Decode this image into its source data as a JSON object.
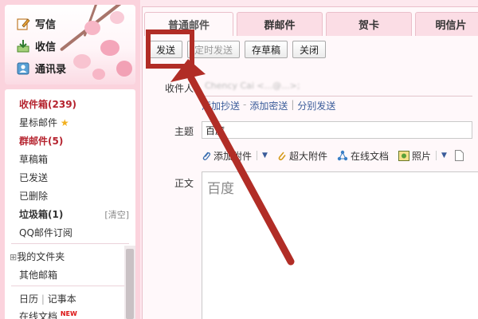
{
  "sidebar": {
    "top_items": [
      {
        "label": "写信",
        "icon": "pencil-icon"
      },
      {
        "label": "收信",
        "icon": "inbox-download-icon"
      },
      {
        "label": "通讯录",
        "icon": "contacts-icon"
      }
    ],
    "folders": [
      {
        "label": "收件箱",
        "count": "(239)"
      },
      {
        "label": "星标邮件",
        "icon": "star-icon"
      },
      {
        "label": "群邮件",
        "count": "(5)"
      },
      {
        "label": "草稿箱"
      },
      {
        "label": "已发送"
      },
      {
        "label": "已删除"
      },
      {
        "label": "垃圾箱",
        "count": "(1)",
        "action": "[清空]"
      },
      {
        "label": "QQ邮件订阅"
      }
    ],
    "lower_items": [
      {
        "label": "我的文件夹",
        "toggle": "⊞"
      },
      {
        "label": "其他邮箱"
      },
      {
        "label": "日历",
        "extra": "记事本"
      },
      {
        "label": "在线文档",
        "badge": "NEW"
      }
    ],
    "colors": {
      "accent": "#b5232e",
      "panel": "#fbd3dd"
    }
  },
  "tabs": [
    "普通邮件",
    "群邮件",
    "贺卡",
    "明信片"
  ],
  "toolbar": {
    "send": "发送",
    "scheduled_send": "定时发送",
    "save_draft": "存草稿",
    "close": "关闭"
  },
  "compose": {
    "recipient_label": "收件人",
    "recipient_value": "Chency Cai <...@...>;",
    "cc_links": [
      "添加抄送",
      "添加密送",
      "分别发送"
    ],
    "subject_label": "主题",
    "subject_value": "百度",
    "attachments": [
      {
        "label": "添加附件",
        "icon": "paperclip-icon",
        "dropdown": true
      },
      {
        "label": "超大附件",
        "icon": "large-attachment-icon"
      },
      {
        "label": "在线文档",
        "icon": "share-doc-icon"
      },
      {
        "label": "照片",
        "icon": "photo-icon",
        "dropdown": true
      }
    ],
    "body_label": "正文",
    "body_value": "百度"
  },
  "annotation": {
    "color": "#b12d26"
  }
}
